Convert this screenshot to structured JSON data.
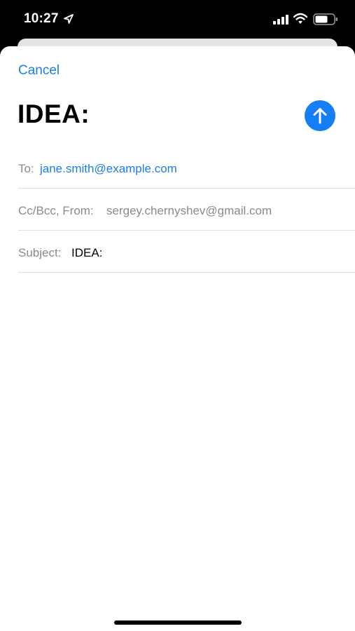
{
  "status_bar": {
    "time": "10:27",
    "icons": [
      "location-arrow-icon",
      "cellular-signal-icon",
      "wifi-icon",
      "battery-icon"
    ]
  },
  "compose": {
    "cancel_label": "Cancel",
    "title": "IDEA:",
    "send_icon": "arrow-up-icon",
    "to_label": "To:",
    "to_value": "jane.smith@example.com",
    "ccbcc_label": "Cc/Bcc, From:",
    "from_value": "sergey.chernyshev@gmail.com",
    "subject_label": "Subject:",
    "subject_value": "IDEA:"
  },
  "colors": {
    "accent": "#1a7ee6",
    "send_button": "#167ef5",
    "label_gray": "#8a8a8e",
    "divider": "#e2e2e4"
  }
}
